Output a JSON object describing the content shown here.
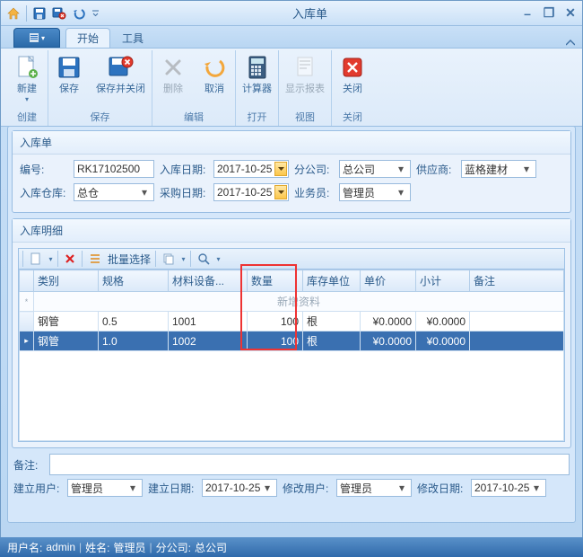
{
  "window": {
    "title": "入库单",
    "minimize": "–",
    "restore": "❐",
    "close": "✕"
  },
  "ribbon": {
    "tabs": {
      "start": "开始",
      "tools": "工具"
    },
    "groups": {
      "create": "创建",
      "save": "保存",
      "edit": "编辑",
      "open": "打开",
      "view": "视图",
      "close_gr": "关闭"
    },
    "buttons": {
      "new": "新建",
      "save": "保存",
      "save_close": "保存并关闭",
      "delete": "删除",
      "cancel": "取消",
      "calculator": "计算器",
      "show_report": "显示报表",
      "close": "关闭"
    }
  },
  "form": {
    "panel_title": "入库单",
    "labels": {
      "doc_no": "编号:",
      "in_date": "入库日期:",
      "branch": "分公司:",
      "supplier": "供应商:",
      "warehouse": "入库仓库:",
      "purchase_date": "采购日期:",
      "clerk": "业务员:"
    },
    "values": {
      "doc_no": "RK17102500",
      "in_date": "2017-10-25",
      "branch": "总公司",
      "supplier": "蓝格建材",
      "warehouse": "总仓",
      "purchase_date": "2017-10-25",
      "clerk": "管理员"
    }
  },
  "detail": {
    "panel_title": "入库明细",
    "toolbar": {
      "batch_select": "批量选择"
    },
    "columns": {
      "category": "类别",
      "spec": "规格",
      "material": "材料设备...",
      "qty": "数量",
      "unit": "库存单位",
      "price": "单价",
      "subtotal": "小计",
      "remark": "备注"
    },
    "newrow_text": "新增资料",
    "rows": [
      {
        "category": "钢管",
        "spec": "0.5",
        "material": "1001",
        "qty": "100",
        "unit": "根",
        "price": "¥0.0000",
        "subtotal": "¥0.0000",
        "remark": ""
      },
      {
        "category": "钢管",
        "spec": "1.0",
        "material": "1002",
        "qty": "100",
        "unit": "根",
        "price": "¥0.0000",
        "subtotal": "¥0.0000",
        "remark": ""
      }
    ]
  },
  "remark": {
    "label": "备注:"
  },
  "meta": {
    "labels": {
      "create_user": "建立用户:",
      "create_date": "建立日期:",
      "modify_user": "修改用户:",
      "modify_date": "修改日期:"
    },
    "values": {
      "create_user": "管理员",
      "create_date": "2017-10-25",
      "modify_user": "管理员",
      "modify_date": "2017-10-25"
    }
  },
  "status": {
    "username_label": "用户名:",
    "username": "admin",
    "realname_label": "姓名:",
    "realname": "管理员",
    "branch_label": "分公司:",
    "branch": "总公司"
  }
}
